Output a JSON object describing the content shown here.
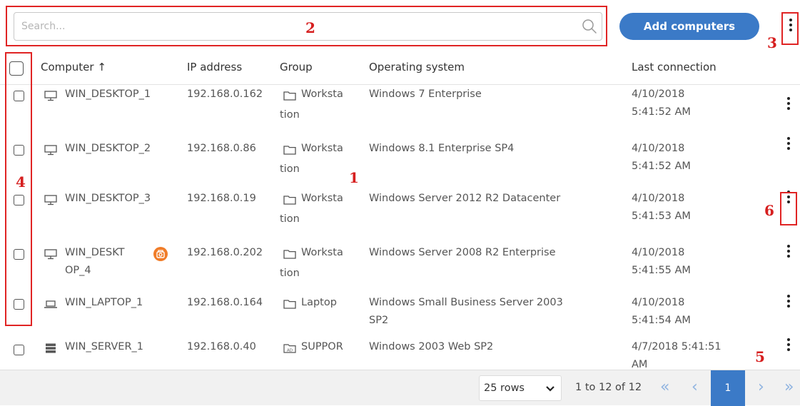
{
  "search": {
    "placeholder": "Search..."
  },
  "toolbar": {
    "add_label": "Add computers"
  },
  "table": {
    "headers": {
      "computer": "Computer ↑",
      "ip": "IP address",
      "group": "Group",
      "os": "Operating system",
      "last": "Last connection"
    },
    "rows": [
      {
        "icon": "desktop-icon",
        "name": [
          "WIN_DESKTOP_1"
        ],
        "ip": "192.168.0.162",
        "group_icon": "folder-icon",
        "group": [
          "Worksta",
          "tion"
        ],
        "os": [
          "Windows 7 Enterprise"
        ],
        "last": [
          "4/10/2018",
          "5:41:52 AM"
        ]
      },
      {
        "icon": "desktop-icon",
        "name": [
          "WIN_DESKTOP_2"
        ],
        "ip": "192.168.0.86",
        "group_icon": "folder-icon",
        "group": [
          "Worksta",
          "tion"
        ],
        "os": [
          "Windows 8.1 Enterprise SP4"
        ],
        "last": [
          "4/10/2018",
          "5:41:52 AM"
        ]
      },
      {
        "icon": "desktop-icon",
        "name": [
          "WIN_DESKTOP_3"
        ],
        "ip": "192.168.0.19",
        "group_icon": "folder-icon",
        "group": [
          "Worksta",
          "tion"
        ],
        "os": [
          "Windows Server 2012 R2 Datacenter"
        ],
        "last": [
          "4/10/2018",
          "5:41:53 AM"
        ]
      },
      {
        "icon": "desktop-icon",
        "name": [
          "WIN_DESKT",
          "OP_4"
        ],
        "badge": "isolation-badge-icon",
        "ip": "192.168.0.202",
        "group_icon": "folder-icon",
        "group": [
          "Worksta",
          "tion"
        ],
        "os": [
          "Windows Server 2008 R2 Enterprise"
        ],
        "last": [
          "4/10/2018",
          "5:41:55 AM"
        ]
      },
      {
        "icon": "laptop-icon",
        "name": [
          "WIN_LAPTOP_1"
        ],
        "ip": "192.168.0.164",
        "group_icon": "folder-icon",
        "group": [
          "Laptop"
        ],
        "os": [
          "Windows Small Business Server 2003",
          "SP2"
        ],
        "last": [
          "4/10/2018",
          "5:41:54 AM"
        ]
      },
      {
        "icon": "server-icon",
        "name": [
          "WIN_SERVER_1"
        ],
        "ip": "192.168.0.40",
        "group_icon": "active-directory-folder-icon",
        "group": [
          "SUPPOR"
        ],
        "os": [
          "Windows 2003 Web SP2"
        ],
        "last": [
          "4/7/2018 5:41:51",
          "AM"
        ]
      }
    ]
  },
  "pagination": {
    "rows_per_page": "25 rows",
    "range": "1 to 12 of 12",
    "current_page": "1",
    "first": "«",
    "prev": "‹",
    "next": "›",
    "last": "»"
  },
  "annotations": [
    "1",
    "2",
    "3",
    "4",
    "5",
    "6"
  ],
  "colors": {
    "accent": "#3b7ac7",
    "annotation": "#e02424",
    "badge": "#f07c28"
  }
}
